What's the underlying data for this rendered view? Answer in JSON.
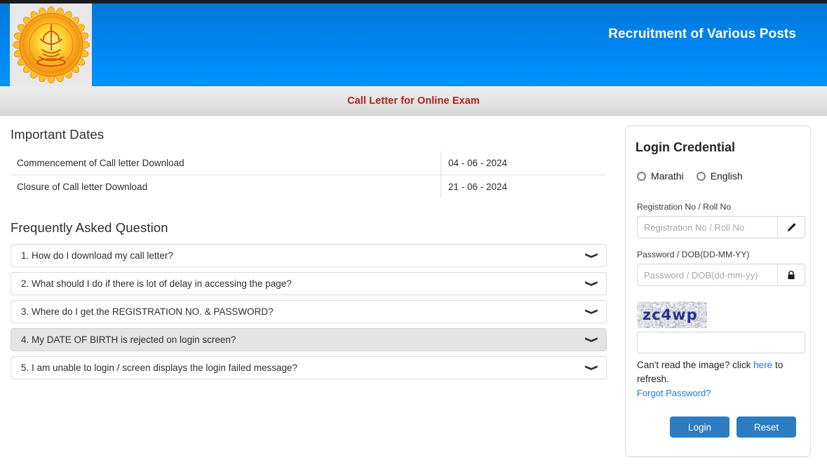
{
  "header": {
    "banner_title": "Recruitment of Various Posts",
    "subbar_title": "Call Letter for Online Exam",
    "logo_alt": "maharashtra-government-emblem"
  },
  "important_dates": {
    "heading": "Important Dates",
    "rows": [
      {
        "label": "Commencement of Call letter Download",
        "value": "04 - 06 - 2024"
      },
      {
        "label": "Closure of Call letter Download",
        "value": "21 - 06 - 2024"
      }
    ]
  },
  "faq": {
    "heading": "Frequently Asked Question",
    "items": [
      {
        "text": "1. How do I download my call letter?",
        "active": false
      },
      {
        "text": "2. What should I do if there is lot of delay in accessing the page?",
        "active": false
      },
      {
        "text": "3. Where do I get the REGISTRATION NO. & PASSWORD?",
        "active": false
      },
      {
        "text": "4. My DATE OF BIRTH is rejected on login screen?",
        "active": true
      },
      {
        "text": "5. I am unable to login / screen displays the login failed message?",
        "active": false
      }
    ],
    "caret_icon": "chevron-down-icon"
  },
  "login": {
    "title": "Login Credential",
    "languages": [
      {
        "label": "Marathi",
        "selected": false
      },
      {
        "label": "English",
        "selected": false
      }
    ],
    "registration": {
      "label": "Registration No / Roll No",
      "placeholder": "Registration No / Roll No",
      "value": "",
      "addon_icon": "pencil-icon"
    },
    "password": {
      "label": "Password / DOB(DD-MM-YY)",
      "placeholder": "Password / DOB(dd-mm-yy)",
      "value": "",
      "addon_icon": "lock-icon"
    },
    "captcha": {
      "image_text": "zc4wp",
      "input_value": "",
      "input_placeholder": "",
      "refresh_prefix": "Can't read the image? click ",
      "refresh_link": "here",
      "refresh_suffix": " to refresh.",
      "forgot_link": "Forgot Password?"
    },
    "buttons": {
      "login": "Login",
      "reset": "Reset"
    }
  },
  "colors": {
    "banner_top": "#0077d6",
    "banner_bottom": "#0093ff",
    "subbar_text": "#b11f24",
    "primary_button": "#2b7cc0",
    "link": "#1e7ad6",
    "captcha_text": "#2a2f8f",
    "faq_active_bg": "#e4e4e4"
  }
}
